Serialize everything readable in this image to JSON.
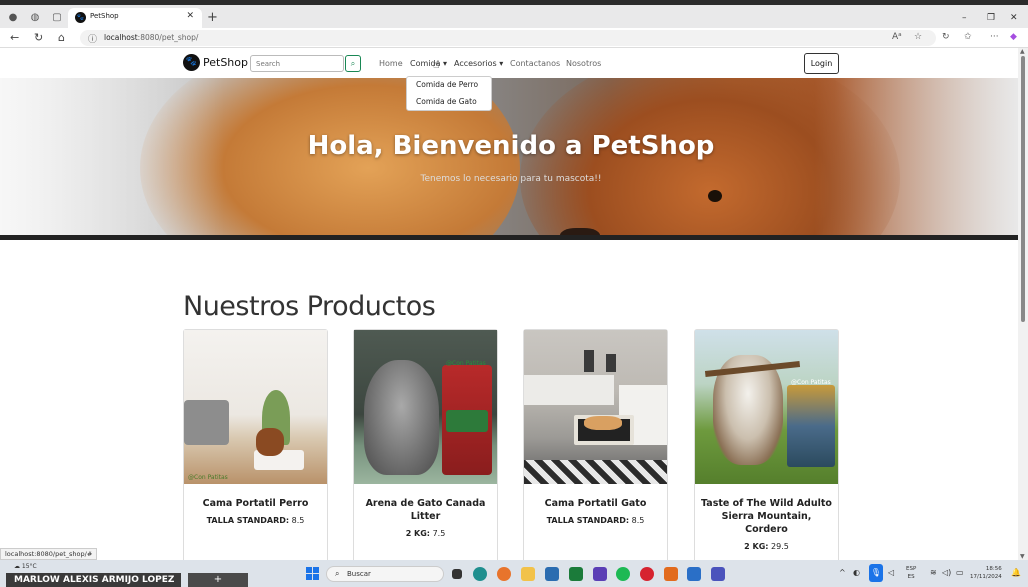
{
  "browser": {
    "tab_title": "PetShop",
    "url_host": "localhost",
    "url_rest": ":8080/pet_shop/",
    "status_url": "localhost:8080/pet_shop/#"
  },
  "navbar": {
    "brand": "PetShop",
    "search_placeholder": "Search",
    "links": {
      "home": "Home",
      "comida": "Comida",
      "accesorios": "Accesorios",
      "contactanos": "Contactanos",
      "nosotros": "Nosotros"
    },
    "login": "Login",
    "dropdown": [
      "Comida de Perro",
      "Comida de Gato"
    ]
  },
  "hero": {
    "title": "Hola, Bienvenido a PetShop",
    "subtitle": "Tenemos lo necesario para tu mascota!!"
  },
  "products_title": "Nuestros Productos",
  "products": [
    {
      "name": "Cama Portatil Perro",
      "meta_label": "TALLA STANDARD:",
      "meta_value": "8.5",
      "image_text": "@Con Patitas"
    },
    {
      "name": "Arena de Gato Canada Litter",
      "meta_label": "2 KG:",
      "meta_value": "7.5",
      "image_text": "@Con Patitas"
    },
    {
      "name": "Cama Portatil Gato",
      "meta_label": "TALLA STANDARD:",
      "meta_value": "8.5",
      "image_text": ""
    },
    {
      "name": "Taste of The Wild Adulto Sierra Mountain, Cordero",
      "meta_label": "2 KG:",
      "meta_value": "29.5",
      "image_text": "@Con Patitas"
    }
  ],
  "taskbar": {
    "user": "MARLOW ALEXIS ARMIJO LOPEZ",
    "weather": "15°C",
    "search": "Buscar",
    "lang1": "ESP",
    "lang2": "ES",
    "time": "18:56",
    "date": "17/11/2024"
  }
}
